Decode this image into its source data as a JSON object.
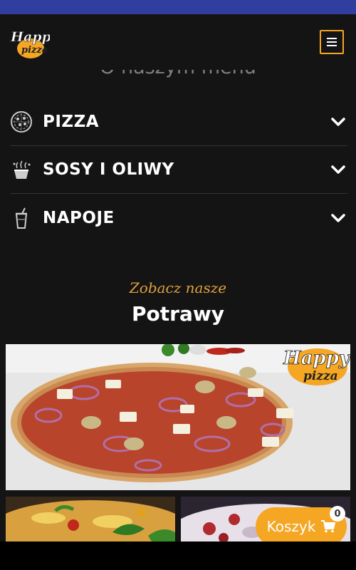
{
  "brand": {
    "logo_line1": "Happy",
    "logo_line2": "pizza"
  },
  "header": {
    "menu_icon": "hamburger-icon"
  },
  "menu_section": {
    "title": "O naszym menu",
    "items": [
      {
        "label": "PIZZA",
        "icon": "pizza-icon"
      },
      {
        "label": "SOSY I OLIWY",
        "icon": "sauce-bowl-icon"
      },
      {
        "label": "NAPOJE",
        "icon": "drink-cup-icon"
      }
    ]
  },
  "dishes": {
    "subtitle": "Zobacz nasze",
    "heading": "Potrawy",
    "photo_logo_line1": "Happy",
    "photo_logo_line2": "pizza"
  },
  "cart": {
    "label": "Koszyk",
    "count": "0",
    "icon": "cart-icon"
  },
  "colors": {
    "accent": "#f5a623",
    "statusbar": "#303f9f",
    "background": "#141414"
  }
}
